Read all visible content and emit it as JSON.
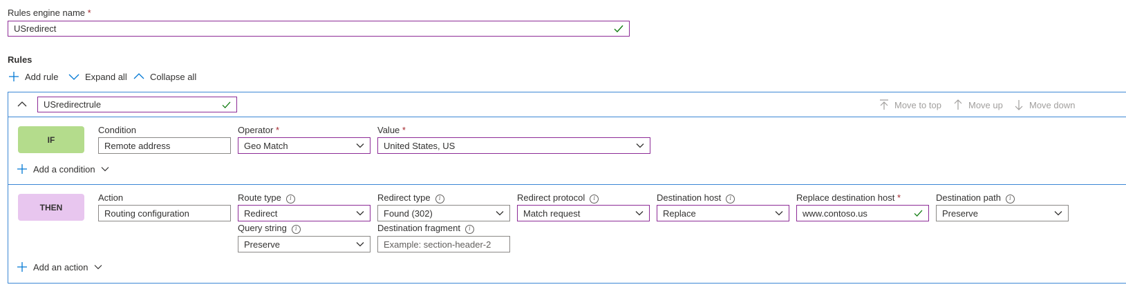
{
  "engine": {
    "label": "Rules engine name",
    "required_mark": "*",
    "value": "USredirect"
  },
  "rules_heading": "Rules",
  "toolbar": {
    "add_rule": "Add rule",
    "expand_all": "Expand all",
    "collapse_all": "Collapse all"
  },
  "rule": {
    "name": "USredirectrule",
    "move_to_top": "Move to top",
    "move_up": "Move up",
    "move_down": "Move down"
  },
  "if_block": {
    "tag": "IF",
    "condition_label": "Condition",
    "condition_value": "Remote address",
    "operator_label": "Operator",
    "operator_value": "Geo Match",
    "value_label": "Value",
    "value_value": "United States, US",
    "add_condition": "Add a condition"
  },
  "then_block": {
    "tag": "THEN",
    "action_label": "Action",
    "action_value": "Routing configuration",
    "route_type_label": "Route type",
    "route_type_value": "Redirect",
    "redirect_type_label": "Redirect type",
    "redirect_type_value": "Found (302)",
    "redirect_protocol_label": "Redirect protocol",
    "redirect_protocol_value": "Match request",
    "destination_host_label": "Destination host",
    "destination_host_value": "Replace",
    "replace_host_label": "Replace destination host",
    "replace_host_value": "www.contoso.us",
    "destination_path_label": "Destination path",
    "destination_path_value": "Preserve",
    "query_string_label": "Query string",
    "query_string_value": "Preserve",
    "fragment_label": "Destination fragment",
    "fragment_placeholder": "Example: section-header-2",
    "add_action": "Add an action"
  },
  "colors": {
    "if_tag": "#b4dc8c",
    "then_tag": "#e8c6ef",
    "highlight_border": "#8c2a96",
    "check": "#107c10",
    "accent": "#0078d4",
    "rule_border": "#3a86d4"
  }
}
